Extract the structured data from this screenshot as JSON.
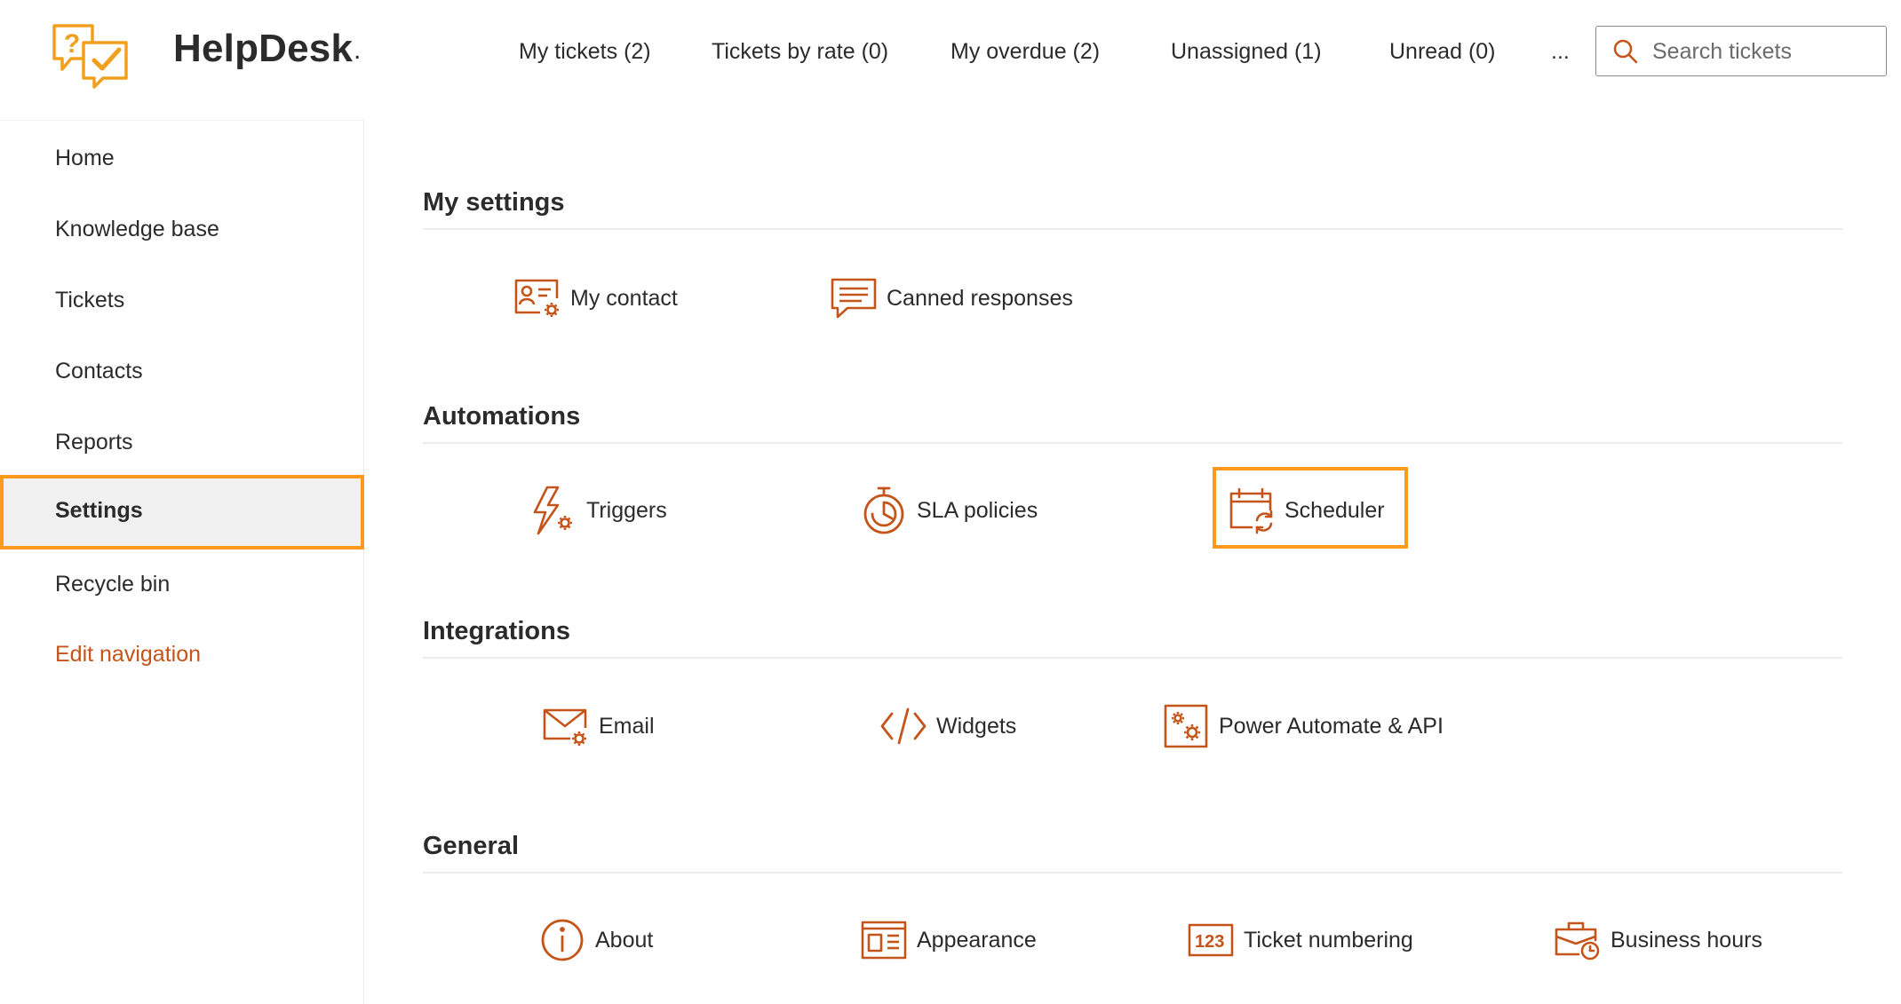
{
  "app": {
    "title": "HelpDesk",
    "title_suffix": "."
  },
  "topnav": {
    "items": [
      {
        "label": "My tickets (2)"
      },
      {
        "label": "Tickets by rate (0)"
      },
      {
        "label": "My overdue (2)"
      },
      {
        "label": "Unassigned (1)"
      },
      {
        "label": "Unread (0)"
      },
      {
        "label": "..."
      }
    ]
  },
  "search": {
    "placeholder": "Search tickets",
    "icon": "search-icon"
  },
  "sidebar": {
    "items": [
      {
        "label": "Home"
      },
      {
        "label": "Knowledge base"
      },
      {
        "label": "Tickets"
      },
      {
        "label": "Contacts"
      },
      {
        "label": "Reports"
      },
      {
        "label": "Settings",
        "active": true
      },
      {
        "label": "Recycle bin"
      },
      {
        "label": "Edit navigation"
      }
    ]
  },
  "sections": [
    {
      "title": "My settings",
      "tiles": [
        {
          "label": "My contact",
          "icon": "contact-card-gear-icon"
        },
        {
          "label": "Canned responses",
          "icon": "chat-message-icon"
        }
      ]
    },
    {
      "title": "Automations",
      "tiles": [
        {
          "label": "Triggers",
          "icon": "lightning-gear-icon"
        },
        {
          "label": "SLA policies",
          "icon": "stopwatch-icon"
        },
        {
          "label": "Scheduler",
          "icon": "calendar-refresh-icon",
          "highlighted": true
        }
      ]
    },
    {
      "title": "Integrations",
      "tiles": [
        {
          "label": "Email",
          "icon": "envelope-gear-icon"
        },
        {
          "label": "Widgets",
          "icon": "code-icon"
        },
        {
          "label": "Power Automate & API",
          "icon": "gears-box-icon"
        }
      ]
    },
    {
      "title": "General",
      "tiles": [
        {
          "label": "About",
          "icon": "info-icon"
        },
        {
          "label": "Appearance",
          "icon": "layout-icon"
        },
        {
          "label": "Ticket numbering",
          "icon": "number-123-icon"
        },
        {
          "label": "Business hours",
          "icon": "briefcase-clock-icon"
        }
      ]
    }
  ],
  "colors": {
    "accent": "#ff9a1f",
    "icon": "#c4541a",
    "logo": "#f0a01e"
  }
}
